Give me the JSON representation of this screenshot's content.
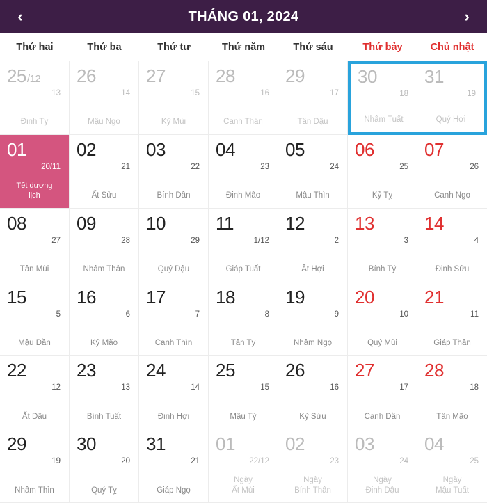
{
  "header": {
    "prev_label": "‹",
    "prev_icon": "chevron-left-icon",
    "next_label": "›",
    "next_icon": "chevron-right-icon",
    "title": "THÁNG 01, 2024"
  },
  "colors": {
    "header_bg": "#3D1E46",
    "highlight_bg": "#D4557F",
    "weekend_text": "#e03030",
    "selection_border": "#29A3DC",
    "other_month_text": "#bbbbbb"
  },
  "weekdays": [
    {
      "label": "Thứ hai",
      "weekend": false
    },
    {
      "label": "Thứ ba",
      "weekend": false
    },
    {
      "label": "Thứ tư",
      "weekend": false
    },
    {
      "label": "Thứ năm",
      "weekend": false
    },
    {
      "label": "Thứ sáu",
      "weekend": false
    },
    {
      "label": "Thứ bảy",
      "weekend": true
    },
    {
      "label": "Chủ nhật",
      "weekend": true
    }
  ],
  "days": [
    {
      "solar": "25",
      "solar_sup": "/12",
      "lunar": "13",
      "name": "Đinh Tỵ"
    },
    {
      "solar": "26",
      "solar_sup": "",
      "lunar": "14",
      "name": "Mậu Ngọ"
    },
    {
      "solar": "27",
      "solar_sup": "",
      "lunar": "15",
      "name": "Kỷ Mùi"
    },
    {
      "solar": "28",
      "solar_sup": "",
      "lunar": "16",
      "name": "Canh Thân"
    },
    {
      "solar": "29",
      "solar_sup": "",
      "lunar": "17",
      "name": "Tân Dậu"
    },
    {
      "solar": "30",
      "solar_sup": "",
      "lunar": "18",
      "name": "Nhâm Tuất"
    },
    {
      "solar": "31",
      "solar_sup": "",
      "lunar": "19",
      "name": "Quý Hợi"
    },
    {
      "solar": "01",
      "solar_sup": "",
      "lunar": "20/11",
      "name": "Tết dương\nlịch"
    },
    {
      "solar": "02",
      "solar_sup": "",
      "lunar": "21",
      "name": "Ất Sửu"
    },
    {
      "solar": "03",
      "solar_sup": "",
      "lunar": "22",
      "name": "Bính Dần"
    },
    {
      "solar": "04",
      "solar_sup": "",
      "lunar": "23",
      "name": "Đinh Mão"
    },
    {
      "solar": "05",
      "solar_sup": "",
      "lunar": "24",
      "name": "Mậu Thìn"
    },
    {
      "solar": "06",
      "solar_sup": "",
      "lunar": "25",
      "name": "Kỷ Tỵ"
    },
    {
      "solar": "07",
      "solar_sup": "",
      "lunar": "26",
      "name": "Canh Ngọ"
    },
    {
      "solar": "08",
      "solar_sup": "",
      "lunar": "27",
      "name": "Tân Mùi"
    },
    {
      "solar": "09",
      "solar_sup": "",
      "lunar": "28",
      "name": "Nhâm Thân"
    },
    {
      "solar": "10",
      "solar_sup": "",
      "lunar": "29",
      "name": "Quý Dậu"
    },
    {
      "solar": "11",
      "solar_sup": "",
      "lunar": "1/12",
      "name": "Giáp Tuất"
    },
    {
      "solar": "12",
      "solar_sup": "",
      "lunar": "2",
      "name": "Ất Hợi"
    },
    {
      "solar": "13",
      "solar_sup": "",
      "lunar": "3",
      "name": "Bính Tý"
    },
    {
      "solar": "14",
      "solar_sup": "",
      "lunar": "4",
      "name": "Đinh Sửu"
    },
    {
      "solar": "15",
      "solar_sup": "",
      "lunar": "5",
      "name": "Mậu Dần"
    },
    {
      "solar": "16",
      "solar_sup": "",
      "lunar": "6",
      "name": "Kỷ Mão"
    },
    {
      "solar": "17",
      "solar_sup": "",
      "lunar": "7",
      "name": "Canh Thìn"
    },
    {
      "solar": "18",
      "solar_sup": "",
      "lunar": "8",
      "name": "Tân Tỵ"
    },
    {
      "solar": "19",
      "solar_sup": "",
      "lunar": "9",
      "name": "Nhâm Ngọ"
    },
    {
      "solar": "20",
      "solar_sup": "",
      "lunar": "10",
      "name": "Quý Mùi"
    },
    {
      "solar": "21",
      "solar_sup": "",
      "lunar": "11",
      "name": "Giáp Thân"
    },
    {
      "solar": "22",
      "solar_sup": "",
      "lunar": "12",
      "name": "Ất Dậu"
    },
    {
      "solar": "23",
      "solar_sup": "",
      "lunar": "13",
      "name": "Bính Tuất"
    },
    {
      "solar": "24",
      "solar_sup": "",
      "lunar": "14",
      "name": "Đinh Hợi"
    },
    {
      "solar": "25",
      "solar_sup": "",
      "lunar": "15",
      "name": "Mậu Tý"
    },
    {
      "solar": "26",
      "solar_sup": "",
      "lunar": "16",
      "name": "Kỷ Sửu"
    },
    {
      "solar": "27",
      "solar_sup": "",
      "lunar": "17",
      "name": "Canh Dần"
    },
    {
      "solar": "28",
      "solar_sup": "",
      "lunar": "18",
      "name": "Tân Mão"
    },
    {
      "solar": "29",
      "solar_sup": "",
      "lunar": "19",
      "name": "Nhâm Thìn"
    },
    {
      "solar": "30",
      "solar_sup": "",
      "lunar": "20",
      "name": "Quý Tỵ"
    },
    {
      "solar": "31",
      "solar_sup": "",
      "lunar": "21",
      "name": "Giáp Ngọ"
    },
    {
      "solar": "01",
      "solar_sup": "",
      "lunar": "22/12",
      "name": "Ngày\nẤt Mùi"
    },
    {
      "solar": "02",
      "solar_sup": "",
      "lunar": "23",
      "name": "Ngày\nBính Thân"
    },
    {
      "solar": "03",
      "solar_sup": "",
      "lunar": "24",
      "name": "Ngày\nĐinh Dậu"
    },
    {
      "solar": "04",
      "solar_sup": "",
      "lunar": "25",
      "name": "Ngày\nMậu Tuất"
    }
  ]
}
